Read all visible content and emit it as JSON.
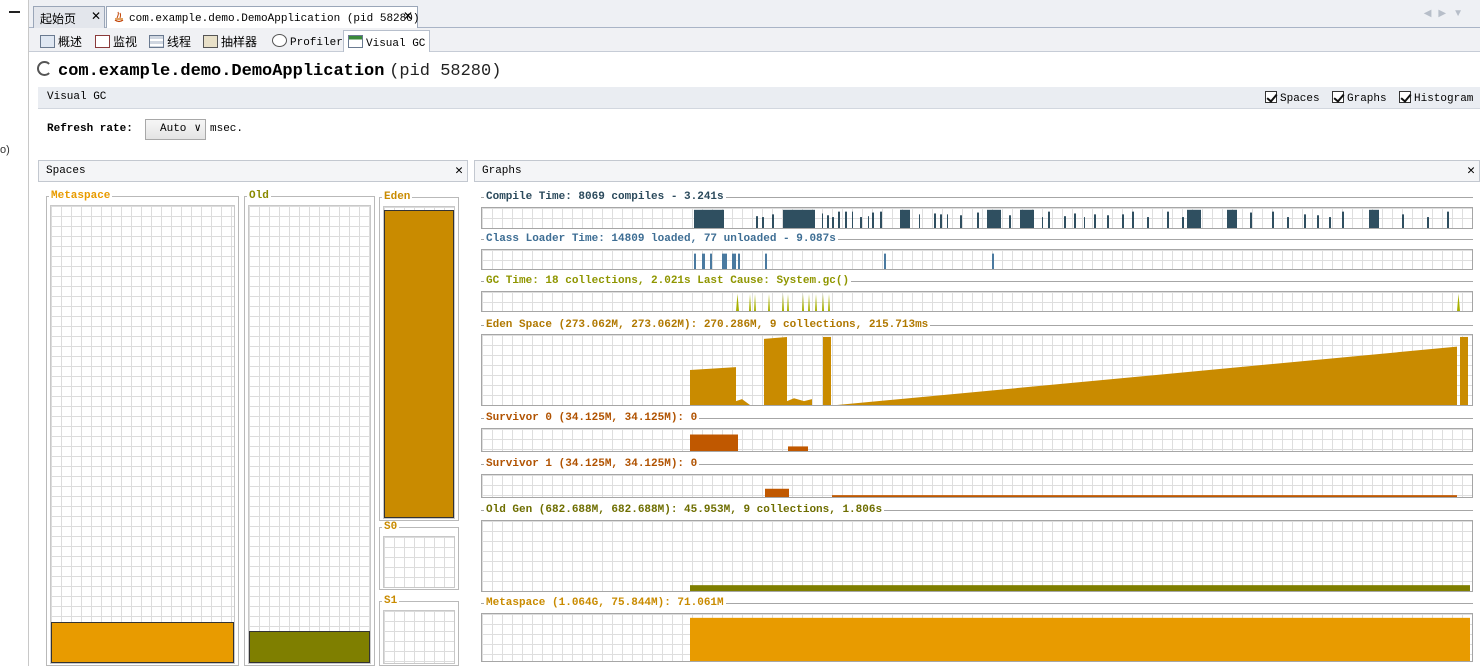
{
  "left_strip": {
    "cut_text": "o)"
  },
  "editor_tabs": [
    {
      "label": "起始页"
    },
    {
      "label": "com.example.demo.DemoApplication (pid 58280)"
    }
  ],
  "sub_tabs": [
    {
      "label": "概述",
      "icon": "overview-icon"
    },
    {
      "label": "监视",
      "icon": "monitor-icon"
    },
    {
      "label": "线程",
      "icon": "threads-icon"
    },
    {
      "label": "抽样器",
      "icon": "sampler-icon"
    },
    {
      "label": "Profiler",
      "icon": "profiler-icon"
    },
    {
      "label": "Visual GC",
      "icon": "visualgc-icon"
    }
  ],
  "heading": {
    "name": "com.example.demo.DemoApplication",
    "pid": "(pid 58280)"
  },
  "visual_gc": {
    "title": "Visual GC",
    "checkboxes": [
      {
        "label": "Spaces",
        "checked": true
      },
      {
        "label": "Graphs",
        "checked": true
      },
      {
        "label": "Histogram",
        "checked": true
      }
    ],
    "refresh_label": "Refresh rate:",
    "refresh_value": "Auto",
    "refresh_unit": "msec."
  },
  "spaces_panel": {
    "title": "Spaces",
    "spaces": [
      {
        "name": "Metaspace",
        "fill_fraction": 0.09,
        "color": "#e89b00"
      },
      {
        "name": "Old",
        "fill_fraction": 0.07,
        "color": "#7f7f00"
      },
      {
        "name": "Eden",
        "fill_fraction": 0.99,
        "color": "#c98b00"
      },
      {
        "name": "S0",
        "fill_fraction": 0.0,
        "color": "#c98b00"
      },
      {
        "name": "S1",
        "fill_fraction": 0.0,
        "color": "#c98b00"
      }
    ]
  },
  "graphs_panel": {
    "title": "Graphs",
    "graphs": [
      {
        "id": "compile",
        "label": "Compile Time: 8069 compiles - 3.241s",
        "color": "#2f4f60",
        "label_color": "#2b4a5c"
      },
      {
        "id": "classloader",
        "label": "Class Loader Time: 14809 loaded, 77 unloaded - 9.087s",
        "color": "#4a7aa0",
        "label_color": "#3e6e94"
      },
      {
        "id": "gc",
        "label": "GC Time: 18 collections, 2.021s  Last Cause: System.gc()",
        "color": "#a8b000",
        "label_color": "#8f9600"
      },
      {
        "id": "eden",
        "label": "Eden Space (273.062M, 273.062M): 270.286M, 9 collections, 215.713ms",
        "color": "#c98b00",
        "label_color": "#b07800"
      },
      {
        "id": "s0",
        "label": "Survivor 0 (34.125M, 34.125M): 0",
        "color": "#c05800",
        "label_color": "#b05200"
      },
      {
        "id": "s1",
        "label": "Survivor 1 (34.125M, 34.125M): 0",
        "color": "#c05800",
        "label_color": "#b05200"
      },
      {
        "id": "oldgen",
        "label": "Old Gen (682.688M, 682.688M): 45.953M, 9 collections, 1.806s",
        "color": "#7f7f00",
        "label_color": "#6e6e00"
      },
      {
        "id": "metaspace",
        "label": "Metaspace (1.064G, 75.844M): 71.061M",
        "color": "#e89b00",
        "label_color": "#c98b00"
      }
    ]
  }
}
